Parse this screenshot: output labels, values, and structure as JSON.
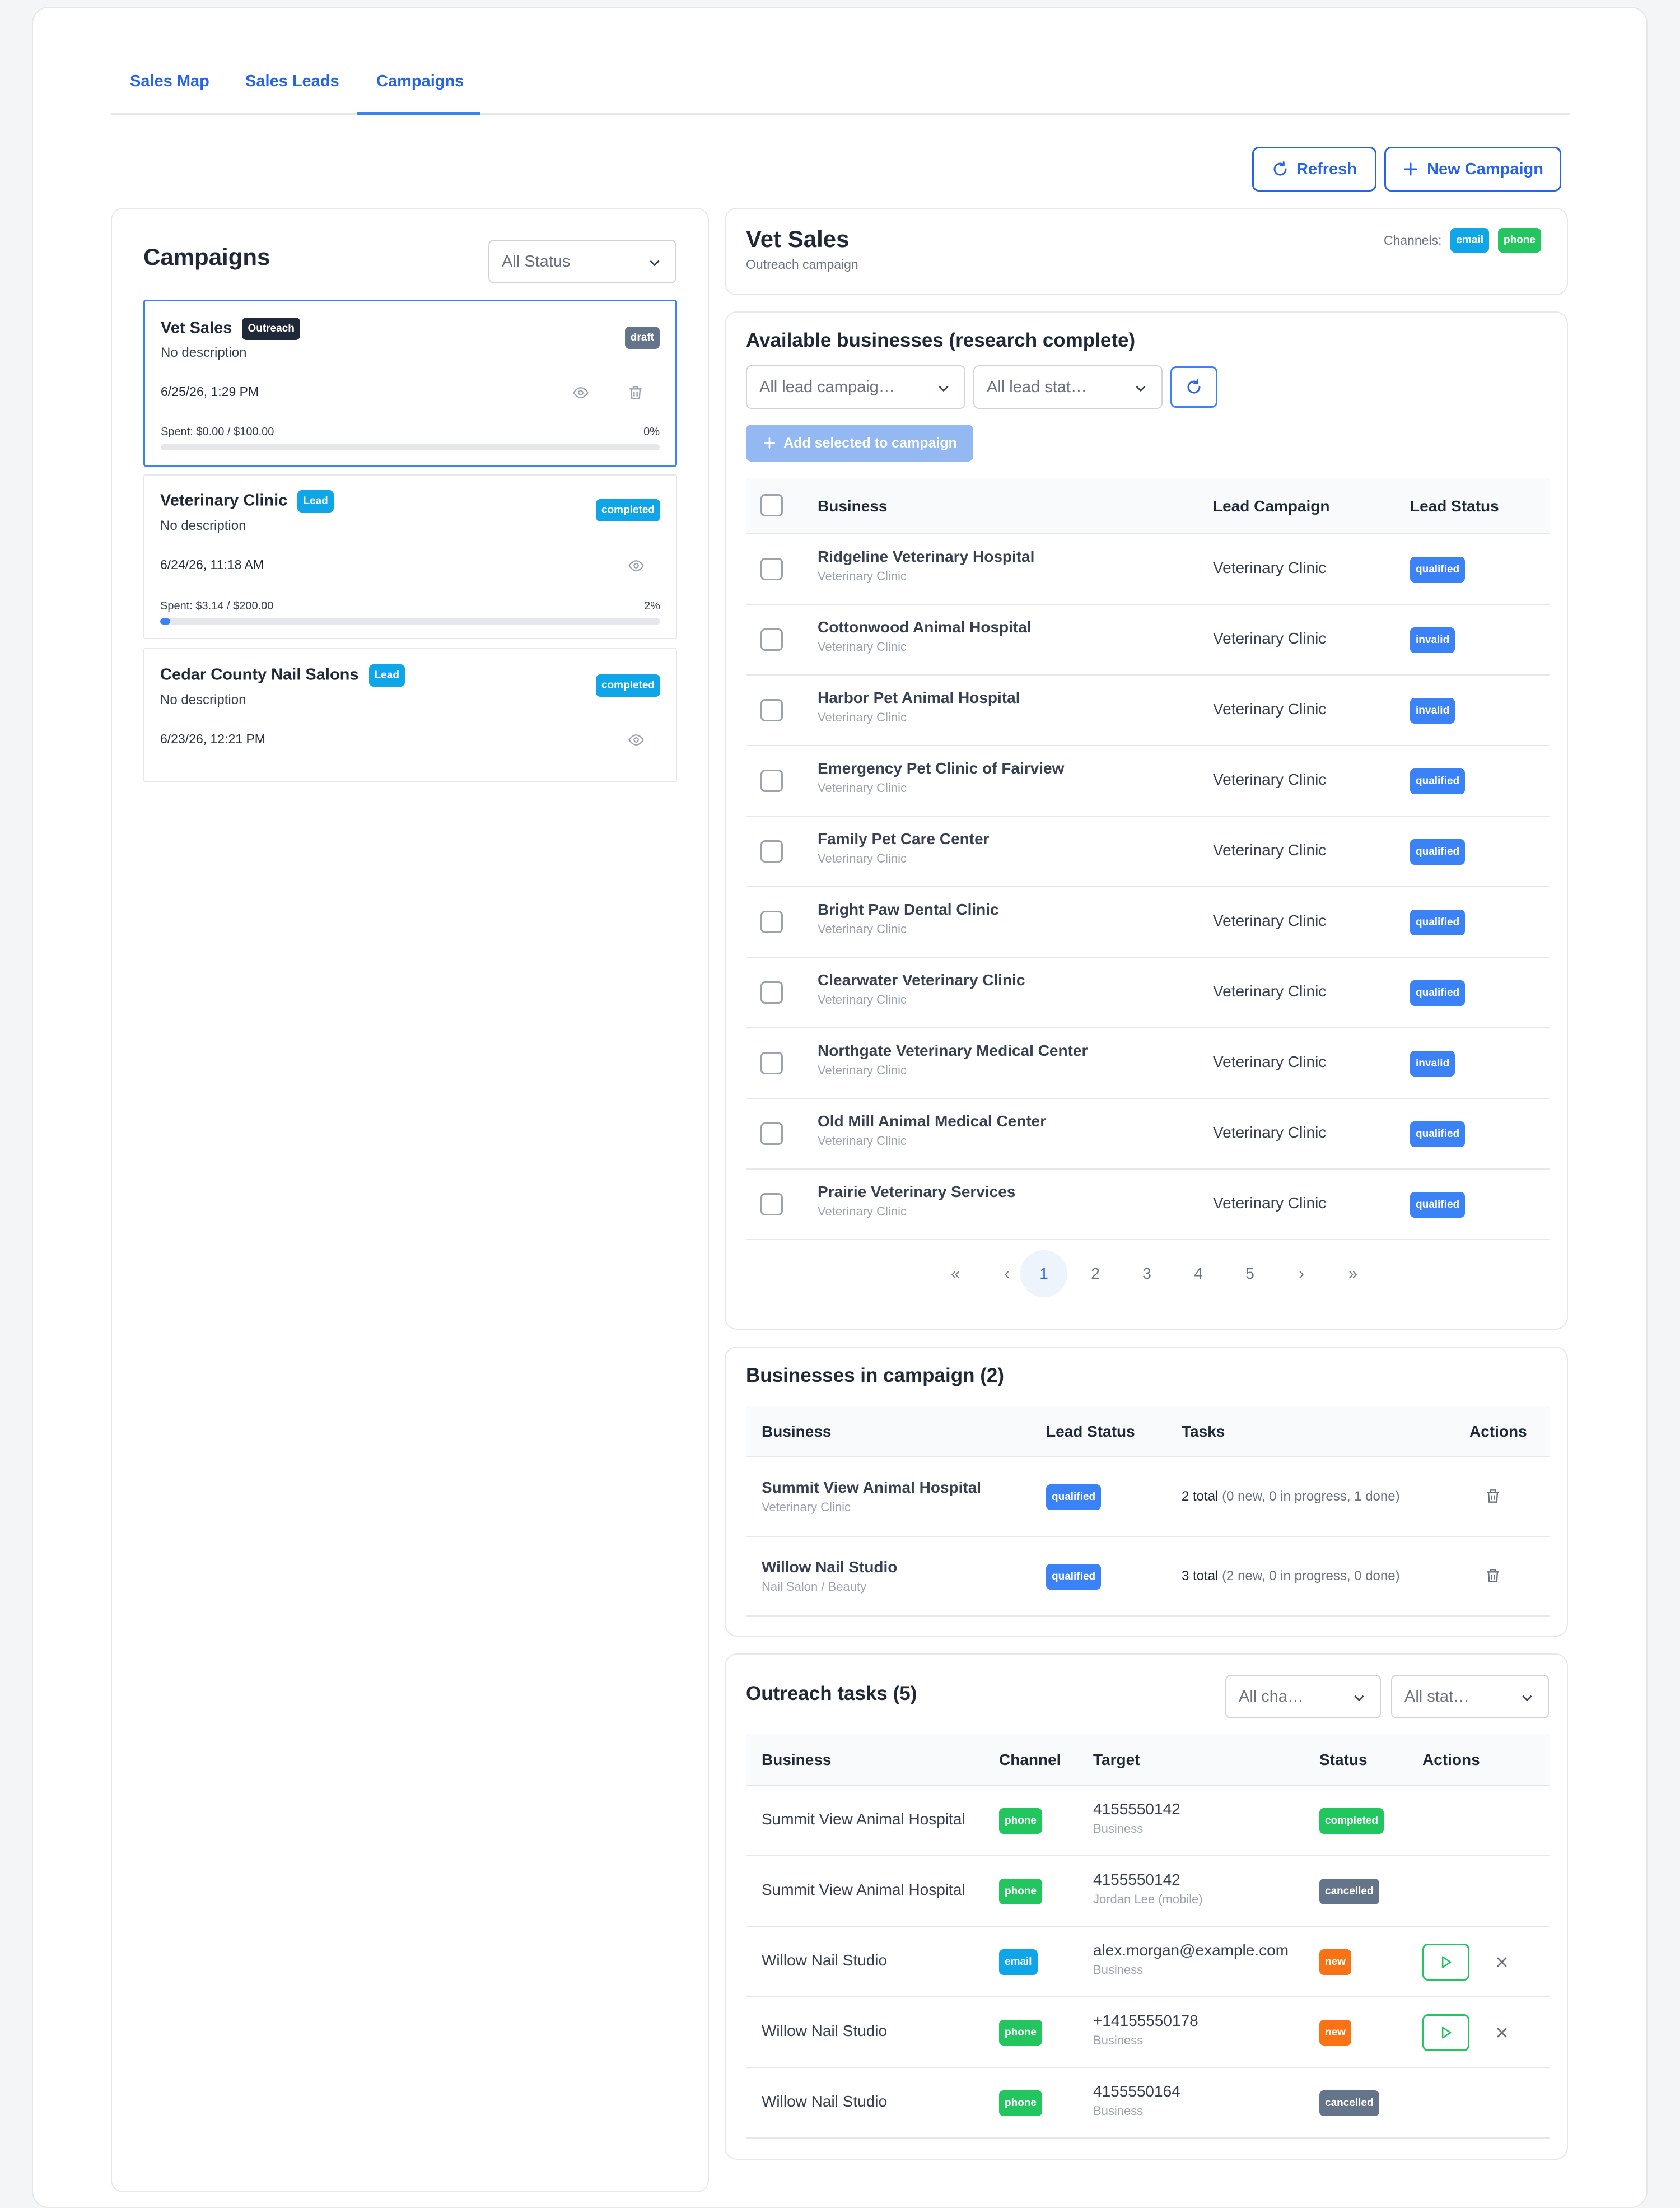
{
  "tabs": [
    "Sales Map",
    "Sales Leads",
    "Campaigns"
  ],
  "toolbar": {
    "refresh": "Refresh",
    "new_campaign": "New Campaign"
  },
  "campaigns_panel": {
    "title": "Campaigns",
    "status_filter": "All Status",
    "items": [
      {
        "name": "Vet Sales",
        "type": "Outreach",
        "status": "draft",
        "description": "No description",
        "date": "6/25/26, 1:29 PM",
        "spent": "Spent: $0.00 / $100.00",
        "pct": "0%",
        "progress": 0
      },
      {
        "name": "Veterinary Clinic",
        "type": "Lead",
        "status": "completed",
        "description": "No description",
        "date": "6/24/26, 11:18 AM",
        "spent": "Spent: $3.14 / $200.00",
        "pct": "2%",
        "progress": 0.02
      },
      {
        "name": "Cedar County Nail Salons",
        "type": "Lead",
        "status": "completed",
        "description": "No description",
        "date": "6/23/26, 12:21 PM"
      }
    ]
  },
  "detail": {
    "title": "Vet Sales",
    "subtitle": "Outreach campaign",
    "channels_label": "Channels:",
    "channels": [
      "email",
      "phone"
    ]
  },
  "available": {
    "title": "Available businesses (research complete)",
    "filter_campaign": "All lead campaig…",
    "filter_status": "All lead stat…",
    "add_button": "Add selected to campaign",
    "headers": [
      "Business",
      "Lead Campaign",
      "Lead Status"
    ],
    "rows": [
      {
        "name": "Ridgeline Veterinary Hospital",
        "sub": "Veterinary Clinic",
        "campaign": "Veterinary Clinic",
        "status": "qualified"
      },
      {
        "name": "Cottonwood Animal Hospital",
        "sub": "Veterinary Clinic",
        "campaign": "Veterinary Clinic",
        "status": "invalid"
      },
      {
        "name": "Harbor Pet Animal Hospital",
        "sub": "Veterinary Clinic",
        "campaign": "Veterinary Clinic",
        "status": "invalid"
      },
      {
        "name": "Emergency Pet Clinic of Fairview",
        "sub": "Veterinary Clinic",
        "campaign": "Veterinary Clinic",
        "status": "qualified"
      },
      {
        "name": "Family Pet Care Center",
        "sub": "Veterinary Clinic",
        "campaign": "Veterinary Clinic",
        "status": "qualified"
      },
      {
        "name": "Bright Paw Dental Clinic",
        "sub": "Veterinary Clinic",
        "campaign": "Veterinary Clinic",
        "status": "qualified"
      },
      {
        "name": "Clearwater Veterinary Clinic",
        "sub": "Veterinary Clinic",
        "campaign": "Veterinary Clinic",
        "status": "qualified"
      },
      {
        "name": "Northgate Veterinary Medical Center",
        "sub": "Veterinary Clinic",
        "campaign": "Veterinary Clinic",
        "status": "invalid"
      },
      {
        "name": "Old Mill Animal Medical Center",
        "sub": "Veterinary Clinic",
        "campaign": "Veterinary Clinic",
        "status": "qualified"
      },
      {
        "name": "Prairie Veterinary Services",
        "sub": "Veterinary Clinic",
        "campaign": "Veterinary Clinic",
        "status": "qualified"
      }
    ],
    "pagination": {
      "first": "«",
      "prev": "‹",
      "pages": [
        "1",
        "2",
        "3",
        "4",
        "5"
      ],
      "current": "1",
      "next": "›",
      "last": "»"
    }
  },
  "in_campaign": {
    "title": "Businesses in campaign (2)",
    "headers": [
      "Business",
      "Lead Status",
      "Tasks",
      "Actions"
    ],
    "rows": [
      {
        "name": "Summit View Animal Hospital",
        "sub": "Veterinary Clinic",
        "status": "qualified",
        "tasks_total": "2 total",
        "tasks_detail": "(0 new, 0 in progress, 1 done)"
      },
      {
        "name": "Willow Nail Studio",
        "sub": "Nail Salon / Beauty",
        "status": "qualified",
        "tasks_total": "3 total",
        "tasks_detail": "(2 new, 0 in progress, 0 done)"
      }
    ]
  },
  "tasks": {
    "title": "Outreach tasks (5)",
    "filter_channel": "All cha…",
    "filter_status": "All stat…",
    "headers": [
      "Business",
      "Channel",
      "Target",
      "Status",
      "Actions"
    ],
    "rows": [
      {
        "business": "Summit View Animal Hospital",
        "channel": "phone",
        "target": "4155550142",
        "target_sub": "Business",
        "status": "completed"
      },
      {
        "business": "Summit View Animal Hospital",
        "channel": "phone",
        "target": "4155550142",
        "target_sub": "Jordan Lee (mobile)",
        "status": "cancelled"
      },
      {
        "business": "Willow Nail Studio",
        "channel": "email",
        "target": "alex.morgan@example.com",
        "target_sub": "Business",
        "status": "new"
      },
      {
        "business": "Willow Nail Studio",
        "channel": "phone",
        "target": "+14155550178",
        "target_sub": "Business",
        "status": "new"
      },
      {
        "business": "Willow Nail Studio",
        "channel": "phone",
        "target": "4155550164",
        "target_sub": "Business",
        "status": "cancelled"
      }
    ]
  },
  "colors": {
    "accent": "#2563eb",
    "qualified": "#3b82f6",
    "phone": "#22c55e",
    "email": "#0ea5e9",
    "new": "#f97316",
    "cancelled": "#64748b",
    "completed": "#22c55e",
    "draft": "#64748b"
  }
}
